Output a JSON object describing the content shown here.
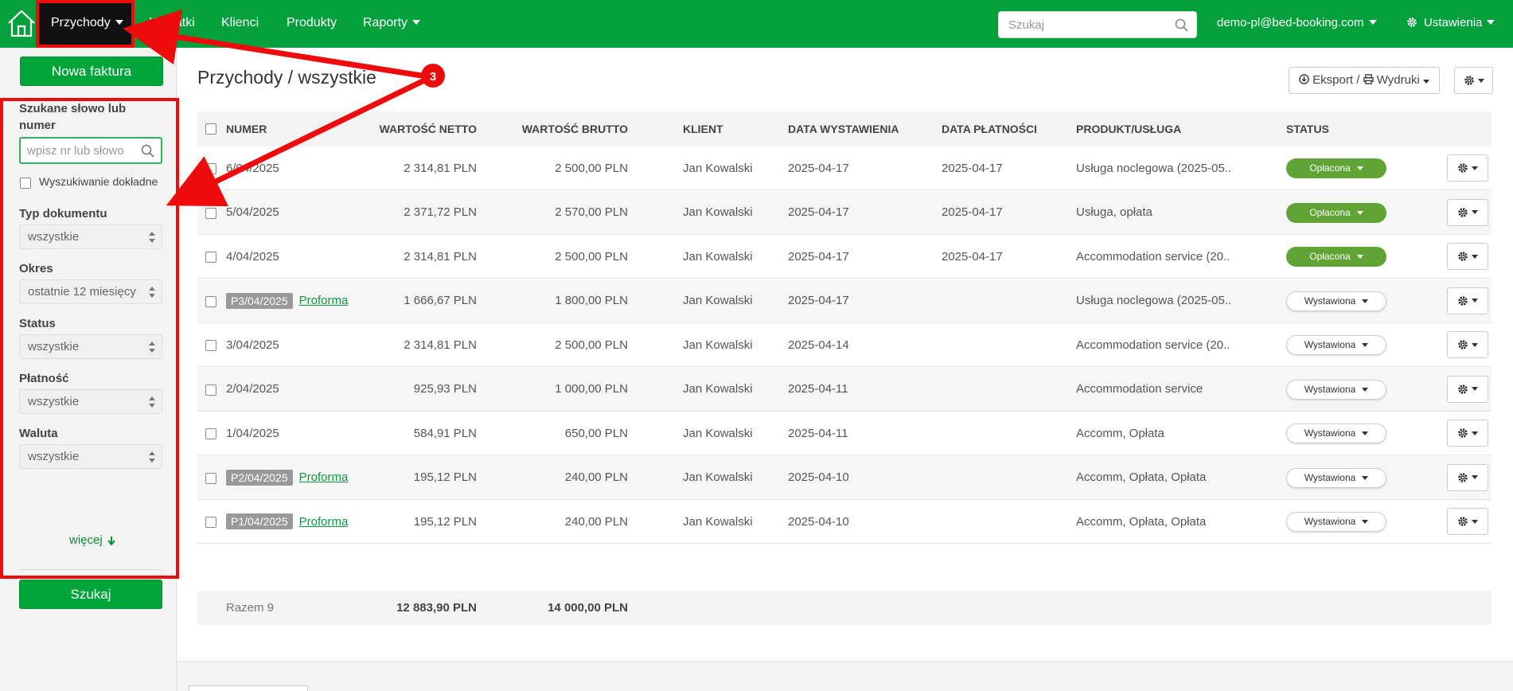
{
  "nav": {
    "active": "Przychody",
    "items": [
      "Wydatki",
      "Klienci",
      "Produkty",
      "Raporty"
    ],
    "search_placeholder": "Szukaj",
    "user": "demo-pl@bed-booking.com",
    "settings": "Ustawienia"
  },
  "sidebar": {
    "new_invoice": "Nowa faktura",
    "search_label": "Szukane słowo lub numer",
    "search_placeholder": "wpisz nr lub słowo",
    "exact_search": "Wyszukiwanie dokładne",
    "doc_type_label": "Typ dokumentu",
    "doc_type_value": "wszystkie",
    "period_label": "Okres",
    "period_value": "ostatnie 12 miesięcy",
    "status_label": "Status",
    "status_value": "wszystkie",
    "payment_label": "Płatność",
    "payment_value": "wszystkie",
    "currency_label": "Waluta",
    "currency_value": "wszystkie",
    "more": "więcej",
    "search_button": "Szukaj"
  },
  "main": {
    "title": "Przychody / wszystkie",
    "export_label": "Eksport / ",
    "print_label": "Wydruki"
  },
  "table": {
    "headers": {
      "number": "NUMER",
      "net": "WARTOŚĆ NETTO",
      "gross": "WARTOŚĆ BRUTTO",
      "client": "KLIENT",
      "issue_date": "DATA WYSTAWIENIA",
      "payment_date": "DATA PŁATNOŚCI",
      "product": "PRODUKT/USŁUGA",
      "status": "STATUS"
    },
    "rows": [
      {
        "number": "6/04/2025",
        "net": "2 314,81 PLN",
        "gross": "2 500,00 PLN",
        "client": "Jan Kowalski",
        "issue": "2025-04-17",
        "payment": "2025-04-17",
        "product": "Usługa noclegowa (2025-05..",
        "status": "Opłacona"
      },
      {
        "number": "5/04/2025",
        "net": "2 371,72 PLN",
        "gross": "2 570,00 PLN",
        "client": "Jan Kowalski",
        "issue": "2025-04-17",
        "payment": "2025-04-17",
        "product": "Usługa, opłata",
        "status": "Opłacona"
      },
      {
        "number": "4/04/2025",
        "net": "2 314,81 PLN",
        "gross": "2 500,00 PLN",
        "client": "Jan Kowalski",
        "issue": "2025-04-17",
        "payment": "2025-04-17",
        "product": "Accommodation service (20..",
        "status": "Opłacona"
      },
      {
        "number": "P3/04/2025",
        "tag": "Proforma",
        "net": "1 666,67 PLN",
        "gross": "1 800,00 PLN",
        "client": "Jan Kowalski",
        "issue": "2025-04-17",
        "payment": "",
        "product": "Usługa noclegowa (2025-05..",
        "status": "Wystawiona"
      },
      {
        "number": "3/04/2025",
        "net": "2 314,81 PLN",
        "gross": "2 500,00 PLN",
        "client": "Jan Kowalski",
        "issue": "2025-04-14",
        "payment": "",
        "product": "Accommodation service (20..",
        "status": "Wystawiona"
      },
      {
        "number": "2/04/2025",
        "net": "925,93 PLN",
        "gross": "1 000,00 PLN",
        "client": "Jan Kowalski",
        "issue": "2025-04-11",
        "payment": "",
        "product": "Accommodation service",
        "status": "Wystawiona"
      },
      {
        "number": "1/04/2025",
        "net": "584,91 PLN",
        "gross": "650,00 PLN",
        "client": "Jan Kowalski",
        "issue": "2025-04-11",
        "payment": "",
        "product": "Accomm, Opłata",
        "status": "Wystawiona"
      },
      {
        "number": "P2/04/2025",
        "tag": "Proforma",
        "net": "195,12 PLN",
        "gross": "240,00 PLN",
        "client": "Jan Kowalski",
        "issue": "2025-04-10",
        "payment": "",
        "product": "Accomm, Opłata, Opłata",
        "status": "Wystawiona"
      },
      {
        "number": "P1/04/2025",
        "tag": "Proforma",
        "net": "195,12 PLN",
        "gross": "240,00 PLN",
        "client": "Jan Kowalski",
        "issue": "2025-04-10",
        "payment": "",
        "product": "Accomm, Opłata, Opłata",
        "status": "Wystawiona"
      }
    ],
    "footer": {
      "total_label": "Razem 9",
      "net_total": "12 883,90 PLN",
      "gross_total": "14 000,00 PLN"
    }
  },
  "annotation": {
    "step": "3",
    "color": "#ee0b0b"
  },
  "colors": {
    "brand": "#03a03c",
    "paid": "#5fa434"
  }
}
